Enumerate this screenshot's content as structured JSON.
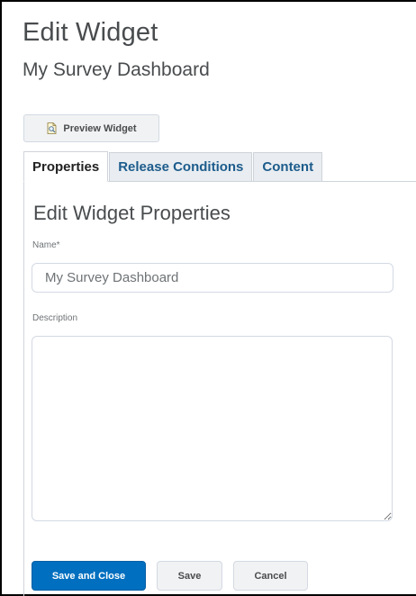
{
  "page": {
    "title": "Edit Widget",
    "subtitle": "My Survey Dashboard"
  },
  "toolbar": {
    "preview_label": "Preview Widget",
    "preview_icon": "document-magnifier-icon"
  },
  "tabs": [
    {
      "label": "Properties",
      "active": true
    },
    {
      "label": "Release Conditions",
      "active": false
    },
    {
      "label": "Content",
      "active": false
    }
  ],
  "form": {
    "section_title": "Edit Widget Properties",
    "name_label": "Name*",
    "name_value": "My Survey Dashboard",
    "description_label": "Description",
    "description_value": ""
  },
  "actions": {
    "save_and_close": "Save and Close",
    "save": "Save",
    "cancel": "Cancel"
  },
  "colors": {
    "primary": "#006fbf",
    "tab_link": "#1d5c8c",
    "text": "#494c4e"
  }
}
